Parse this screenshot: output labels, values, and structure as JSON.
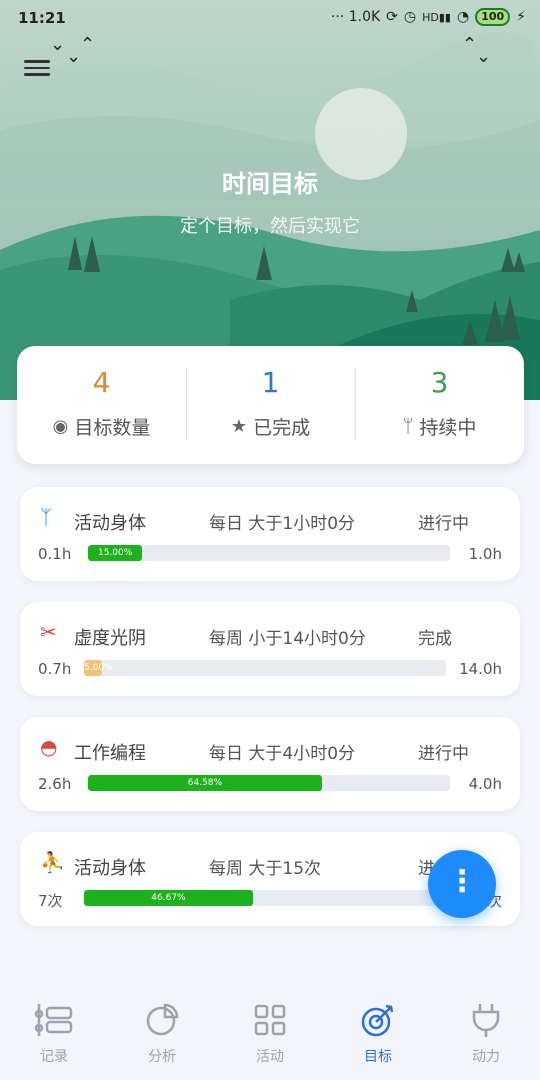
{
  "status_bar": {
    "time": "11:21",
    "net": "··· 1.0K",
    "icons": [
      "sync-icon",
      "alarm-icon",
      "clock-icon",
      "hd-signal-icon",
      "wifi-icon"
    ],
    "battery": "100"
  },
  "header": {
    "title": "时间目标",
    "subtitle": "定个目标，然后实现它"
  },
  "stats": [
    {
      "value": "4",
      "label": "目标数量",
      "color": "#e08a2e",
      "icon": "eye-icon"
    },
    {
      "value": "1",
      "label": "已完成",
      "color": "#2f79c9",
      "icon": "star-icon"
    },
    {
      "value": "3",
      "label": "持续中",
      "color": "#3f9e4c",
      "icon": "fork-icon"
    }
  ],
  "goals": [
    {
      "icon": "person-stretch-icon",
      "icon_color": "#2a8fd8",
      "name": "活动身体",
      "rule": "每日 大于1小时0分",
      "state": "进行中",
      "current": "0.1h",
      "max": "1.0h",
      "progress": 0.15,
      "progress_label": "15.00%",
      "bar_color": "#1db21d"
    },
    {
      "icon": "scissors-icon",
      "icon_color": "#d64b3e",
      "name": "虚度光阴",
      "rule": "每周 小于14小时0分",
      "state": "完成",
      "current": "0.7h",
      "max": "14.0h",
      "progress": 0.05,
      "progress_label": "5.00%",
      "bar_color": "#f2c27a"
    },
    {
      "icon": "bowl-icon",
      "icon_color": "#d64b3e",
      "name": "工作编程",
      "rule": "每日 大于4小时0分",
      "state": "进行中",
      "current": "2.6h",
      "max": "4.0h",
      "progress": 0.6458,
      "progress_label": "64.58%",
      "bar_color": "#1db21d"
    },
    {
      "icon": "runner-icon",
      "icon_color": "#1fa89a",
      "name": "活动身体",
      "rule": "每周 大于15次",
      "state": "进行中",
      "current": "7次",
      "max": "15次",
      "progress": 0.4667,
      "progress_label": "46.67%",
      "bar_color": "#1db21d"
    }
  ],
  "fab": {
    "label": "⋮"
  },
  "nav": [
    {
      "label": "记录",
      "icon": "list-icon"
    },
    {
      "label": "分析",
      "icon": "pie-chart-icon"
    },
    {
      "label": "活动",
      "icon": "grid-icon"
    },
    {
      "label": "目标",
      "icon": "target-icon",
      "active": true
    },
    {
      "label": "动力",
      "icon": "plug-icon"
    }
  ]
}
